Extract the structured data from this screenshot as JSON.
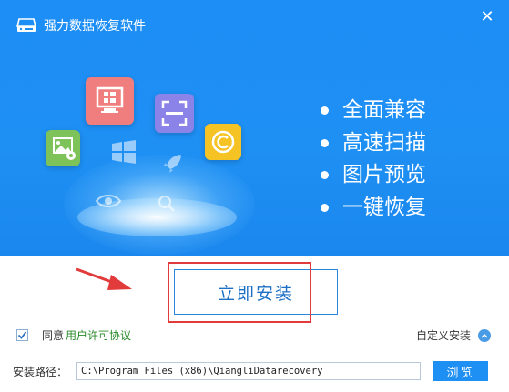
{
  "window": {
    "title": "强力数据恢复软件",
    "close_symbol": "✕"
  },
  "colors": {
    "header_blue": "#1e8ff3",
    "accent_blue": "#2b86d9",
    "highlight_red": "#e23b3b",
    "link_green": "#2a8a2a"
  },
  "features": [
    "全面兼容",
    "高速扫描",
    "图片预览",
    "一键恢复"
  ],
  "install": {
    "label": "立即安装"
  },
  "agreement": {
    "checked": true,
    "prefix": "同意",
    "link": "用户许可协议"
  },
  "custom_install": {
    "label": "自定义安装"
  },
  "path": {
    "label": "安装路径：",
    "value": "C:\\Program Files (x86)\\QiangliDatarecovery"
  },
  "browse": {
    "label": "浏览"
  },
  "icons": [
    "drive-icon",
    "close-icon",
    "image-tile-icon",
    "monitor-windows-icon",
    "scan-frame-icon",
    "copyright-icon",
    "windows-logo-icon",
    "rocket-icon",
    "eye-icon",
    "magnifier-icon",
    "checkmark-icon",
    "chevron-up-icon",
    "red-arrow-icon"
  ]
}
